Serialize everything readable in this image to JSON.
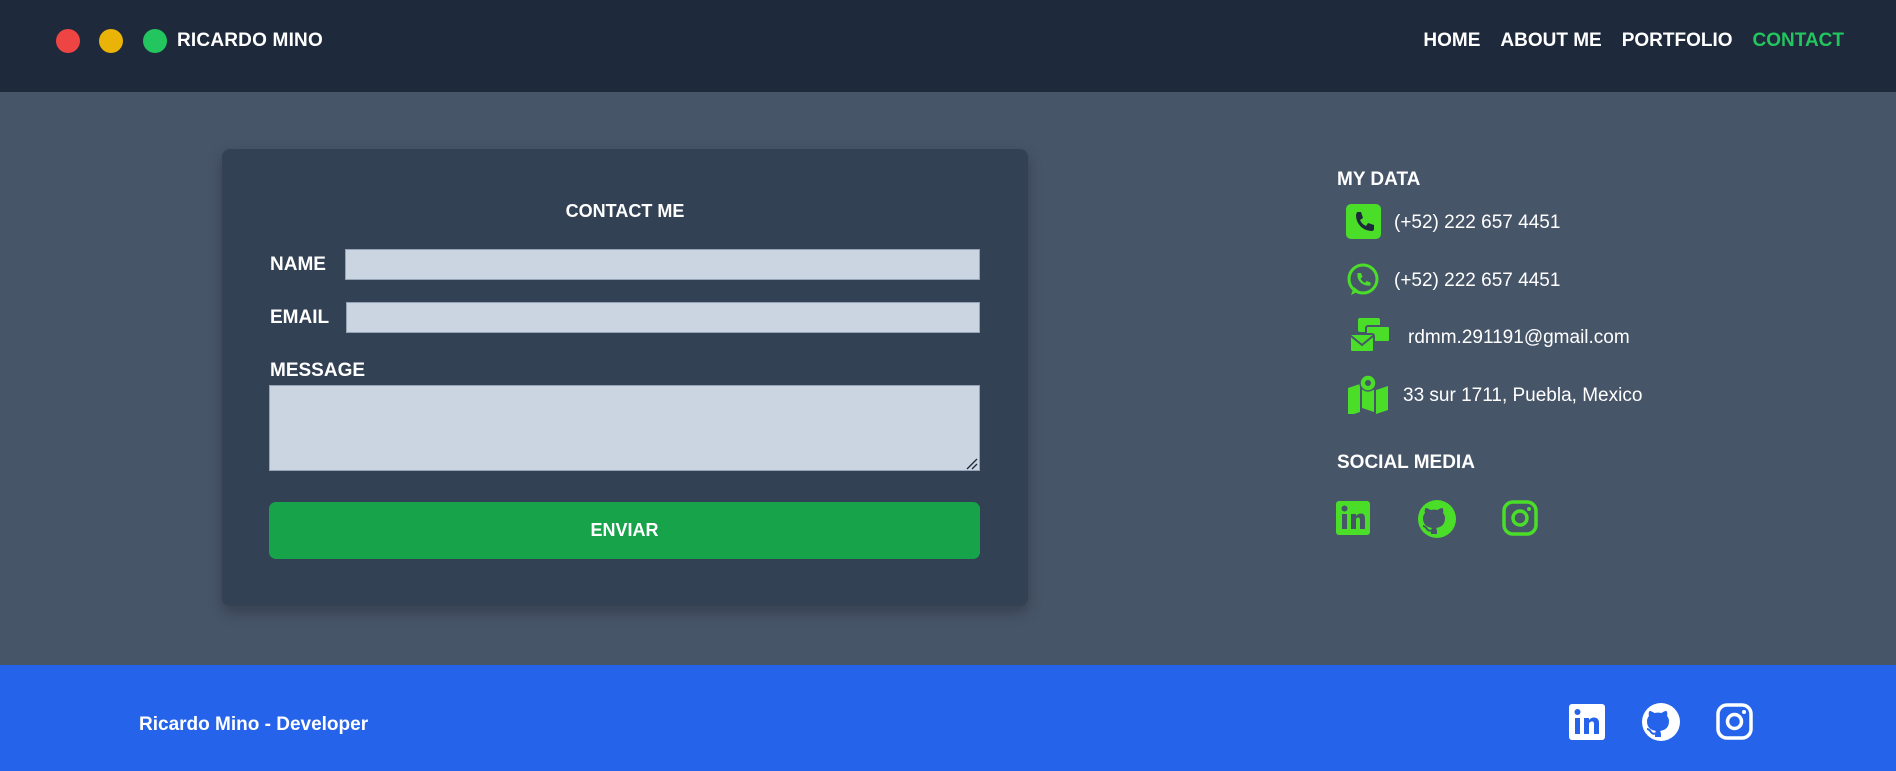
{
  "header": {
    "brand": "RICARDO MINO",
    "nav": [
      "HOME",
      "ABOUT ME",
      "PORTFOLIO",
      "CONTACT"
    ],
    "active_nav": "CONTACT"
  },
  "contact_form": {
    "title": "CONTACT ME",
    "name_label": "NAME",
    "name_value": "",
    "email_label": "EMAIL",
    "email_value": "",
    "message_label": "MESSAGE",
    "message_value": "",
    "submit_label": "ENVIAR"
  },
  "my_data": {
    "title": "MY DATA",
    "items": [
      {
        "icon": "phone-icon",
        "text": "(+52) 222 657 4451"
      },
      {
        "icon": "whatsapp-icon",
        "text": "(+52) 222 657 4451"
      },
      {
        "icon": "email-icon",
        "text": "rdmm.291191@gmail.com"
      },
      {
        "icon": "map-icon",
        "text": "33 sur 1711, Puebla, Mexico"
      }
    ]
  },
  "social_media": {
    "title": "SOCIAL MEDIA",
    "icons": [
      "linkedin-icon",
      "github-icon",
      "instagram-icon"
    ]
  },
  "footer": {
    "text": "Ricardo Mino - Developer",
    "icons": [
      "linkedin-icon",
      "github-icon",
      "instagram-icon"
    ]
  },
  "colors": {
    "header_bg": "#1e293b",
    "page_bg": "#475569",
    "card_bg": "#334155",
    "accent_green": "#22c55e",
    "button_green": "#16a34a",
    "icon_green": "#4ade29",
    "footer_bg": "#2563eb"
  }
}
